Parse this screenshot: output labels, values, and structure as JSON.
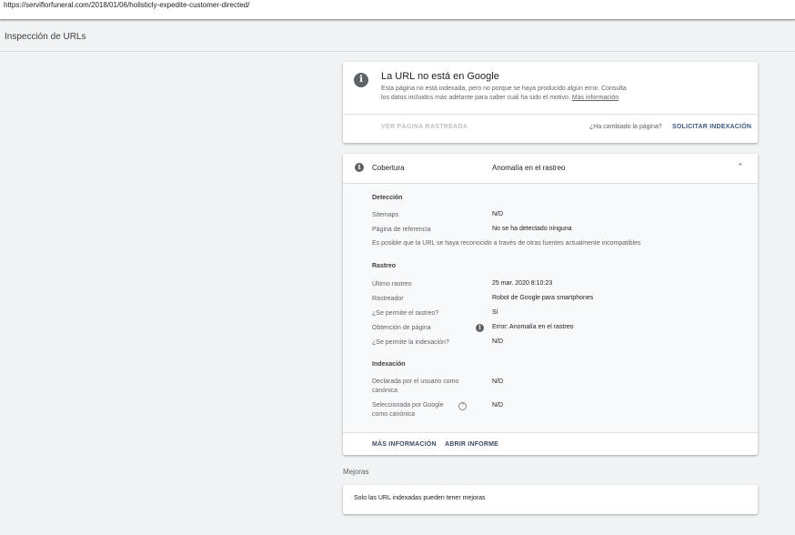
{
  "url_bar": {
    "url": "https://serviflorfuneral.com/2018/01/06/holisticly-expedite-customer-directed/"
  },
  "page": {
    "title": "Inspección de URLs"
  },
  "status_card": {
    "title": "La URL no está en Google",
    "desc_line1": "Esta página no está indexada, pero no porque se haya producido algún error. Consulta",
    "desc_line2": "los datos incluidos más adelante para saber cuál ha sido el motivo.",
    "more_link": "Más información",
    "view_crawled": "VER PÁGINA RASTREADA",
    "changed_question": "¿Ha cambiado la página?",
    "request_indexing": "SOLICITAR INDEXACIÓN"
  },
  "coverage": {
    "label": "Cobertura",
    "status": "Anomalía en el rastreo",
    "detection": {
      "title": "Detección",
      "sitemaps_label": "Sitemaps",
      "sitemaps_value": "N/D",
      "referring_label": "Página de referencia",
      "referring_value": "No se ha detectado ninguna",
      "note": "Es posible que la URL se haya reconocido a través de otras fuentes actualmente incompatibles"
    },
    "crawl": {
      "title": "Rastreo",
      "last_crawl_label": "Último rastreo",
      "last_crawl_value": "25 mar. 2020 8:10:23",
      "crawler_label": "Rastreador",
      "crawler_value": "Robot de Google para smartphones",
      "crawl_allowed_label": "¿Se permite el rastreo?",
      "crawl_allowed_value": "Sí",
      "page_fetch_label": "Obtención de página",
      "page_fetch_value": "Error: Anomalía en el rastreo",
      "index_allowed_label": "¿Se permite la indexación?",
      "index_allowed_value": "N/D"
    },
    "indexing": {
      "title": "Indexación",
      "user_canonical_line1": "Declarada por el usuario como",
      "user_canonical_line2": "canónica",
      "user_canonical_value": "N/D",
      "google_canonical_line1": "Seleccionada por Google",
      "google_canonical_line2": "como canónica",
      "google_canonical_value": "N/D"
    },
    "more_info": "MÁS INFORMACIÓN",
    "open_report": "ABRIR INFORME"
  },
  "enhancements": {
    "label": "Mejoras",
    "note": "Solo las URL indexadas pueden tener mejoras"
  },
  "icons": {
    "info": "i",
    "help": "?",
    "chevron_up": "⌃"
  }
}
